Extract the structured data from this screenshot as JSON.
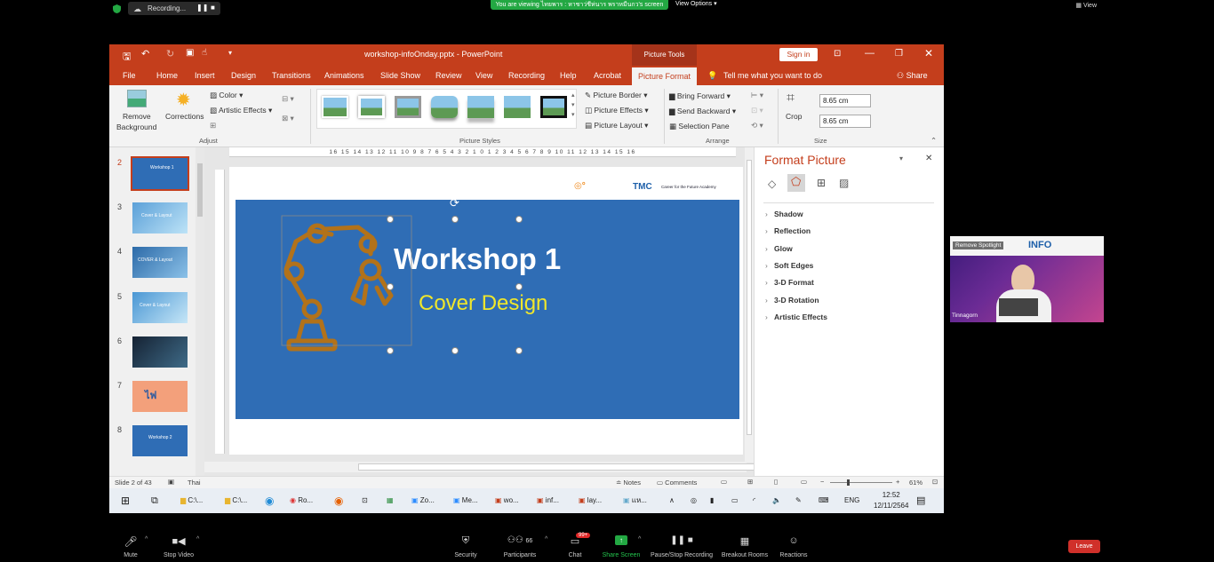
{
  "zoom": {
    "recording": "Recording...",
    "viewing_banner": "You are viewing ไทยพาร : หาชาว่ชีห่นาร พราหมีนกว's screen",
    "view_options": "View Options",
    "view": "View",
    "bottom": {
      "mute": "Mute",
      "stop_video": "Stop Video",
      "security": "Security",
      "participants": "Participants",
      "participants_count": "66",
      "chat": "Chat",
      "chat_badge": "99+",
      "share_screen": "Share Screen",
      "pause_recording": "Pause/Stop Recording",
      "breakout": "Breakout Rooms",
      "reactions": "Reactions",
      "leave": "Leave"
    },
    "camera": {
      "name": "Tinnagorn",
      "spotlight": "Remove Spotlight",
      "overlay_text": "INFO"
    }
  },
  "pp": {
    "filename": "workshop-infoOnday.pptx - PowerPoint",
    "picture_tools": "Picture Tools",
    "sign_in": "Sign in",
    "tabs": [
      "File",
      "Home",
      "Insert",
      "Design",
      "Transitions",
      "Animations",
      "Slide Show",
      "Review",
      "View",
      "Recording",
      "Help",
      "Acrobat",
      "Picture Format"
    ],
    "tell_me": "Tell me what you want to do",
    "share": "Share",
    "ribbon": {
      "remove_bg": "Remove",
      "remove_bg2": "Background",
      "corrections": "Corrections",
      "color": "Color",
      "artistic": "Artistic Effects",
      "adjust": "Adjust",
      "picture_styles": "Picture Styles",
      "border": "Picture Border",
      "effects": "Picture Effects",
      "layout": "Picture Layout",
      "bring_forward": "Bring Forward",
      "send_backward": "Send Backward",
      "selection_pane": "Selection Pane",
      "arrange": "Arrange",
      "crop": "Crop",
      "height": "8.65 cm",
      "width": "8.65 cm",
      "size": "Size"
    },
    "ruler": "16 15 14 13 12 11 10 9 8 7 6 5 4 3 2 1 0 1 2 3 4 5 6 7 8 9 10 11 12 13 14 15 16",
    "thumbs": [
      {
        "n": "2",
        "t": "Workshop 1"
      },
      {
        "n": "3",
        "t": "Cover & Layout"
      },
      {
        "n": "4",
        "t": "COVER & Layout"
      },
      {
        "n": "5",
        "t": "Cover & Layout"
      },
      {
        "n": "6",
        "t": ""
      },
      {
        "n": "7",
        "t": "ไฟ"
      },
      {
        "n": "8",
        "t": "Workshop 2"
      }
    ],
    "slide": {
      "title": "Workshop 1",
      "subtitle": "Cover Design",
      "logo_tmc": "TMC",
      "logo_text": "Career for the Future Academy"
    },
    "format": {
      "title": "Format Picture",
      "items": [
        "Shadow",
        "Reflection",
        "Glow",
        "Soft Edges",
        "3-D Format",
        "3-D Rotation",
        "Artistic Effects"
      ]
    },
    "status": {
      "slide": "Slide 2 of 43",
      "lang": "Thai",
      "notes": "Notes",
      "comments": "Comments",
      "zoom": "61%"
    },
    "taskbar": {
      "items": [
        "C:\\...",
        "C:\\...",
        "Ro...",
        "Zo...",
        "Me...",
        "wo...",
        "inf...",
        "lay...",
        "แห..."
      ],
      "lang": "ENG",
      "time": "12:52",
      "date": "12/11/2564"
    }
  },
  "colors": {
    "ppt": "#c43e1c",
    "slide_blue": "#2f6db5",
    "slide_yellow": "#f0e72b",
    "robot": "#b2721a",
    "zoom_green": "#23a843",
    "leave": "#d0302a"
  }
}
